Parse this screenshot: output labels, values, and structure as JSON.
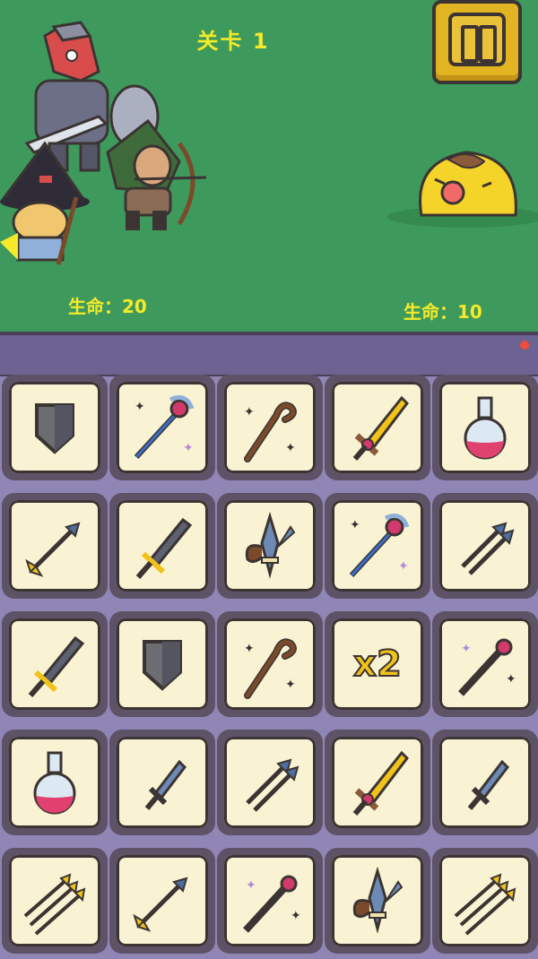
{
  "hud": {
    "level_label": "关卡 1",
    "player_hp_label": "生命：20",
    "enemy_hp_label": "生命：10",
    "pause_icon": "pause-icon"
  },
  "board": {
    "rows": [
      [
        "shield-icon",
        "magic-staff-icon",
        "wooden-staff-icon",
        "golden-sword-icon",
        "potion-icon"
      ],
      [
        "arrow-icon",
        "iron-sword-icon",
        "fleur-trident-icon",
        "magic-staff-icon",
        "double-arrow-icon"
      ],
      [
        "iron-sword-icon",
        "shield-icon",
        "wooden-staff-icon",
        "x2-multiplier",
        "wand-icon"
      ],
      [
        "potion-icon",
        "dagger-icon",
        "double-arrow-icon",
        "golden-sword-icon",
        "dagger-icon"
      ],
      [
        "triple-arrow-icon",
        "arrow-icon",
        "wand-icon",
        "fleur-trident-icon",
        "triple-arrow-icon"
      ]
    ],
    "x2_label": "x2"
  },
  "colors": {
    "field": "#3e9a5c",
    "hud_text": "#f4ea2a",
    "board": "#8f86b6",
    "card": "#f9f3d4",
    "pause_button": "#e2b422"
  }
}
